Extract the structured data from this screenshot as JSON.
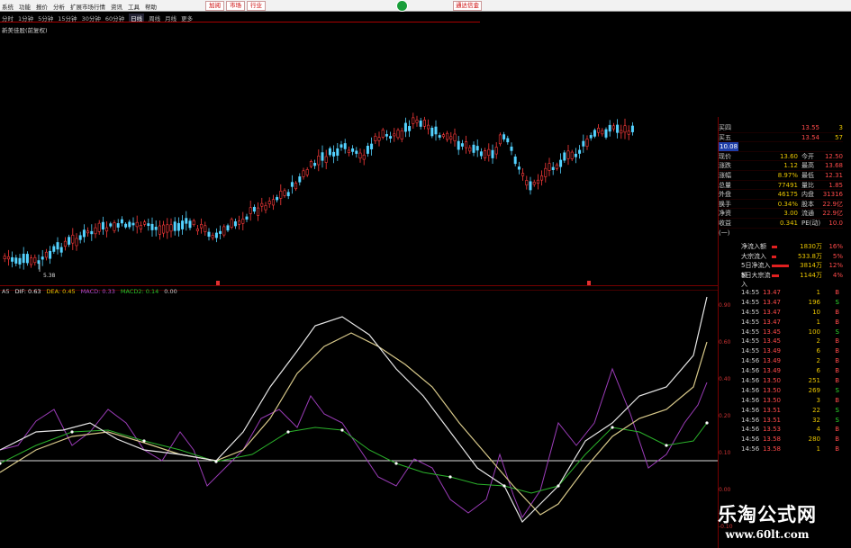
{
  "menu": [
    "系统",
    "功能",
    "报价",
    "分析",
    "扩展市场行情",
    "资讯",
    "工具",
    "帮助"
  ],
  "red_tabs": [
    "加阅",
    "市场",
    "行业"
  ],
  "right_button": "通达信金",
  "periods": [
    "分时",
    "1分钟",
    "5分钟",
    "15分钟",
    "30分钟",
    "60分钟",
    "日线",
    "周线",
    "月线",
    "更多"
  ],
  "stock_label": "新美佳股(前复权)",
  "low_marker": "5.38",
  "macd": {
    "dif_label": "DIF: 0.63",
    "dea_label": "DEA: 0.45",
    "m1_label": "MACD: 0.33",
    "m2_label": "MACD2: 0.14",
    "extra_label": "0.00",
    "prefix": "A5"
  },
  "colors": {
    "up": "#ff3b3b",
    "down": "#54d2ff",
    "dif": "#e7e7e7",
    "dea": "#d8c98a",
    "purple": "#9b3cb8",
    "green": "#2bb32b"
  },
  "quote": {
    "buy_row": {
      "label": "买四",
      "price": "13.55",
      "vol": "3"
    },
    "sell_row": {
      "label": "买五",
      "price": "13.54",
      "vol": "57"
    },
    "badge": "10.08",
    "rows": [
      {
        "l": "现价",
        "v": "13.60",
        "l2": "今开",
        "v2": "12.50"
      },
      {
        "l": "涨跌",
        "v": "1.12",
        "l2": "最高",
        "v2": "13.68"
      },
      {
        "l": "涨幅",
        "v": "8.97%",
        "l2": "最低",
        "v2": "12.31"
      },
      {
        "l": "总量",
        "v": "77491",
        "l2": "量比",
        "v2": "1.85"
      },
      {
        "l": "外盘",
        "v": "46175",
        "l2": "内盘",
        "v2": "31316"
      },
      {
        "l": "换手",
        "v": "0.34%",
        "l2": "股本",
        "v2": "22.9亿"
      },
      {
        "l": "净资",
        "v": "3.00",
        "l2": "流通",
        "v2": "22.9亿"
      },
      {
        "l": "收益(一)",
        "v": "0.341",
        "l2": "PE(动)",
        "v2": "10.0"
      }
    ]
  },
  "flow": [
    {
      "label": "净流入额",
      "bar": 4,
      "value": "1830万",
      "pct": "16%"
    },
    {
      "label": "大宗流入",
      "bar": 3,
      "value": "533.8万",
      "pct": "5%"
    },
    {
      "label": "5日净流入额",
      "bar": 12,
      "value": "3814万",
      "pct": "12%"
    },
    {
      "label": "5日大宗流入",
      "bar": 5,
      "value": "1144万",
      "pct": "4%"
    }
  ],
  "ticks": [
    {
      "t": "14:55",
      "p": "13.47",
      "v": "1",
      "d": "B"
    },
    {
      "t": "14:55",
      "p": "13.47",
      "v": "196",
      "d": "S"
    },
    {
      "t": "14:55",
      "p": "13.47",
      "v": "10",
      "d": "B"
    },
    {
      "t": "14:55",
      "p": "13.47",
      "v": "1",
      "d": "B"
    },
    {
      "t": "14:55",
      "p": "13.45",
      "v": "100",
      "d": "S"
    },
    {
      "t": "14:55",
      "p": "13.45",
      "v": "2",
      "d": "B"
    },
    {
      "t": "14:55",
      "p": "13.49",
      "v": "6",
      "d": "B"
    },
    {
      "t": "14:56",
      "p": "13.49",
      "v": "2",
      "d": "B"
    },
    {
      "t": "14:56",
      "p": "13.49",
      "v": "6",
      "d": "B"
    },
    {
      "t": "14:56",
      "p": "13.50",
      "v": "251",
      "d": "B"
    },
    {
      "t": "14:56",
      "p": "13.50",
      "v": "269",
      "d": "S"
    },
    {
      "t": "14:56",
      "p": "13.50",
      "v": "3",
      "d": "B"
    },
    {
      "t": "14:56",
      "p": "13.51",
      "v": "22",
      "d": "S"
    },
    {
      "t": "14:56",
      "p": "13.51",
      "v": "32",
      "d": "S"
    },
    {
      "t": "14:56",
      "p": "13.53",
      "v": "4",
      "d": "B"
    },
    {
      "t": "14:56",
      "p": "13.58",
      "v": "280",
      "d": "B"
    },
    {
      "t": "14:56",
      "p": "13.58",
      "v": "1",
      "d": "B"
    }
  ],
  "scale_labels": [
    "0.90",
    "0.60",
    "0.40",
    "0.20",
    "0.10",
    "0.00",
    "-0.10"
  ],
  "watermark": {
    "cn": "乐淘公式网",
    "url": "www.60lt.com"
  }
}
